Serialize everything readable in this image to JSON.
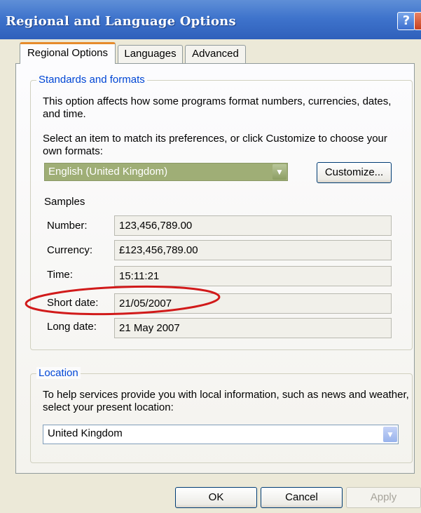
{
  "window": {
    "title": "Regional and Language Options",
    "help_glyph": "?",
    "close_glyph": "✕"
  },
  "tabs": [
    {
      "label": "Regional Options"
    },
    {
      "label": "Languages"
    },
    {
      "label": "Advanced"
    }
  ],
  "standards": {
    "legend": "Standards and formats",
    "description": "This option affects how some programs format numbers, currencies, dates, and time.",
    "select_instruction": "Select an item to match its preferences, or click Customize to choose your own formats:",
    "selected_locale": "English (United Kingdom)",
    "customize_label": "Customize..."
  },
  "samples": {
    "heading": "Samples",
    "rows": [
      {
        "label": "Number:",
        "value": "123,456,789.00"
      },
      {
        "label": "Currency:",
        "value": "£123,456,789.00"
      },
      {
        "label": "Time:",
        "value": "15:11:21"
      },
      {
        "label": "Short date:",
        "value": "21/05/2007"
      },
      {
        "label": "Long date:",
        "value": "21 May 2007"
      }
    ]
  },
  "location": {
    "legend": "Location",
    "description": "To help services provide you with local information, such as news and weather, select your present location:",
    "selected_location": "United Kingdom"
  },
  "buttons": {
    "ok": "OK",
    "cancel": "Cancel",
    "apply": "Apply"
  },
  "colors": {
    "titlebar": "#3f74cc",
    "legend_text": "#0046d5",
    "highlight_ellipse": "#d11a1a",
    "active_tab_border": "#e68b2c"
  }
}
